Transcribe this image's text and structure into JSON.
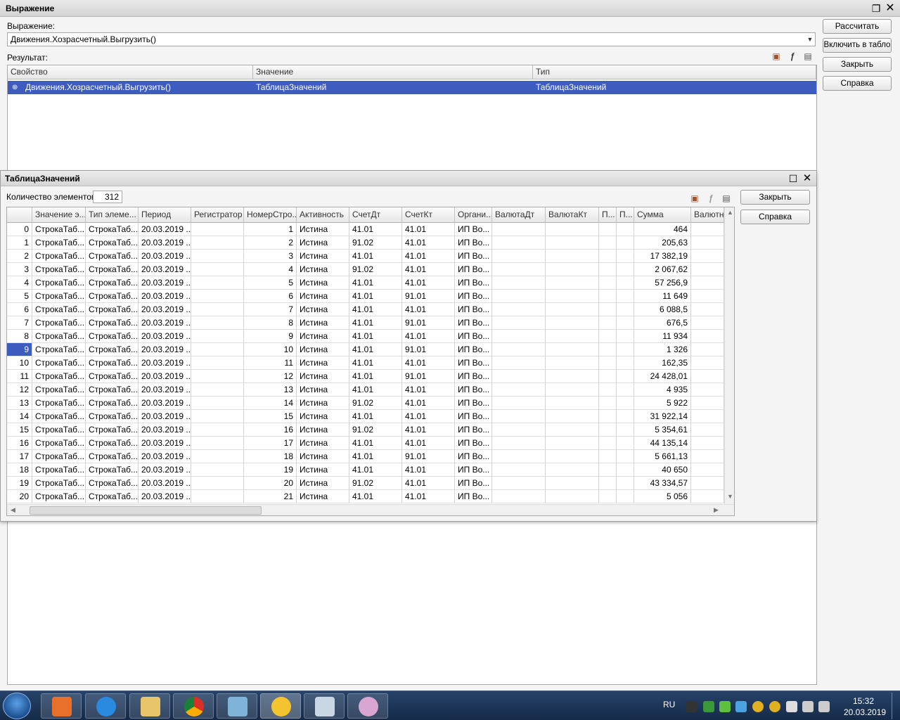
{
  "main": {
    "title": "Выражение",
    "expr_label": "Выражение:",
    "expr_value": "Движения.Хозрасчетный.Выгрузить()",
    "result_label": "Результат:",
    "buttons": {
      "calc": "Рассчитать",
      "include": "Включить в табло",
      "close": "Закрыть",
      "help": "Справка"
    },
    "result_headers": [
      "Свойство",
      "Значение",
      "Тип"
    ],
    "result_row": {
      "property": "Движения.Хозрасчетный.Выгрузить()",
      "value": "ТаблицаЗначений",
      "type": "ТаблицаЗначений"
    }
  },
  "child": {
    "title": "ТаблицаЗначений",
    "count_label": "Количество элементов:",
    "count_value": "312",
    "buttons": {
      "close": "Закрыть",
      "help": "Справка"
    },
    "headers": [
      "Значение э...",
      "Тип элеме...",
      "Период",
      "Регистратор",
      "НомерСтро...",
      "Активность",
      "СчетДт",
      "СчетКт",
      "Органи...",
      "ВалютаДт",
      "ВалютаКт",
      "П...",
      "П...",
      "Сумма",
      "Валютна"
    ],
    "rows": [
      {
        "i": "0",
        "v": "СтрокаТаб...",
        "t": "СтрокаТаб...",
        "p": "20.03.2019 ...",
        "n": "1",
        "a": "Истина",
        "dt": "41.01",
        "kt": "41.01",
        "o": "ИП Во...",
        "s": "464"
      },
      {
        "i": "1",
        "v": "СтрокаТаб...",
        "t": "СтрокаТаб...",
        "p": "20.03.2019 ...",
        "n": "2",
        "a": "Истина",
        "dt": "91.02",
        "kt": "41.01",
        "o": "ИП Во...",
        "s": "205,63"
      },
      {
        "i": "2",
        "v": "СтрокаТаб...",
        "t": "СтрокаТаб...",
        "p": "20.03.2019 ...",
        "n": "3",
        "a": "Истина",
        "dt": "41.01",
        "kt": "41.01",
        "o": "ИП Во...",
        "s": "17 382,19"
      },
      {
        "i": "3",
        "v": "СтрокаТаб...",
        "t": "СтрокаТаб...",
        "p": "20.03.2019 ...",
        "n": "4",
        "a": "Истина",
        "dt": "91.02",
        "kt": "41.01",
        "o": "ИП Во...",
        "s": "2 067,62"
      },
      {
        "i": "4",
        "v": "СтрокаТаб...",
        "t": "СтрокаТаб...",
        "p": "20.03.2019 ...",
        "n": "5",
        "a": "Истина",
        "dt": "41.01",
        "kt": "41.01",
        "o": "ИП Во...",
        "s": "57 256,9"
      },
      {
        "i": "5",
        "v": "СтрокаТаб...",
        "t": "СтрокаТаб...",
        "p": "20.03.2019 ...",
        "n": "6",
        "a": "Истина",
        "dt": "41.01",
        "kt": "91.01",
        "o": "ИП Во...",
        "s": "11 649"
      },
      {
        "i": "6",
        "v": "СтрокаТаб...",
        "t": "СтрокаТаб...",
        "p": "20.03.2019 ...",
        "n": "7",
        "a": "Истина",
        "dt": "41.01",
        "kt": "41.01",
        "o": "ИП Во...",
        "s": "6 088,5"
      },
      {
        "i": "7",
        "v": "СтрокаТаб...",
        "t": "СтрокаТаб...",
        "p": "20.03.2019 ...",
        "n": "8",
        "a": "Истина",
        "dt": "41.01",
        "kt": "91.01",
        "o": "ИП Во...",
        "s": "676,5"
      },
      {
        "i": "8",
        "v": "СтрокаТаб...",
        "t": "СтрокаТаб...",
        "p": "20.03.2019 ...",
        "n": "9",
        "a": "Истина",
        "dt": "41.01",
        "kt": "41.01",
        "o": "ИП Во...",
        "s": "11 934"
      },
      {
        "i": "9",
        "v": "СтрокаТаб...",
        "t": "СтрокаТаб...",
        "p": "20.03.2019 ...",
        "n": "10",
        "a": "Истина",
        "dt": "41.01",
        "kt": "91.01",
        "o": "ИП Во...",
        "s": "1 326",
        "selected": true
      },
      {
        "i": "10",
        "v": "СтрокаТаб...",
        "t": "СтрокаТаб...",
        "p": "20.03.2019 ...",
        "n": "11",
        "a": "Истина",
        "dt": "41.01",
        "kt": "41.01",
        "o": "ИП Во...",
        "s": "162,35"
      },
      {
        "i": "11",
        "v": "СтрокаТаб...",
        "t": "СтрокаТаб...",
        "p": "20.03.2019 ...",
        "n": "12",
        "a": "Истина",
        "dt": "41.01",
        "kt": "91.01",
        "o": "ИП Во...",
        "s": "24 428,01"
      },
      {
        "i": "12",
        "v": "СтрокаТаб...",
        "t": "СтрокаТаб...",
        "p": "20.03.2019 ...",
        "n": "13",
        "a": "Истина",
        "dt": "41.01",
        "kt": "41.01",
        "o": "ИП Во...",
        "s": "4 935"
      },
      {
        "i": "13",
        "v": "СтрокаТаб...",
        "t": "СтрокаТаб...",
        "p": "20.03.2019 ...",
        "n": "14",
        "a": "Истина",
        "dt": "91.02",
        "kt": "41.01",
        "o": "ИП Во...",
        "s": "5 922"
      },
      {
        "i": "14",
        "v": "СтрокаТаб...",
        "t": "СтрокаТаб...",
        "p": "20.03.2019 ...",
        "n": "15",
        "a": "Истина",
        "dt": "41.01",
        "kt": "41.01",
        "o": "ИП Во...",
        "s": "31 922,14"
      },
      {
        "i": "15",
        "v": "СтрокаТаб...",
        "t": "СтрокаТаб...",
        "p": "20.03.2019 ...",
        "n": "16",
        "a": "Истина",
        "dt": "91.02",
        "kt": "41.01",
        "o": "ИП Во...",
        "s": "5 354,61"
      },
      {
        "i": "16",
        "v": "СтрокаТаб...",
        "t": "СтрокаТаб...",
        "p": "20.03.2019 ...",
        "n": "17",
        "a": "Истина",
        "dt": "41.01",
        "kt": "41.01",
        "o": "ИП Во...",
        "s": "44 135,14"
      },
      {
        "i": "17",
        "v": "СтрокаТаб...",
        "t": "СтрокаТаб...",
        "p": "20.03.2019 ...",
        "n": "18",
        "a": "Истина",
        "dt": "41.01",
        "kt": "91.01",
        "o": "ИП Во...",
        "s": "5 661,13"
      },
      {
        "i": "18",
        "v": "СтрокаТаб...",
        "t": "СтрокаТаб...",
        "p": "20.03.2019 ...",
        "n": "19",
        "a": "Истина",
        "dt": "41.01",
        "kt": "41.01",
        "o": "ИП Во...",
        "s": "40 650"
      },
      {
        "i": "19",
        "v": "СтрокаТаб...",
        "t": "СтрокаТаб...",
        "p": "20.03.2019 ...",
        "n": "20",
        "a": "Истина",
        "dt": "91.02",
        "kt": "41.01",
        "o": "ИП Во...",
        "s": "43 334,57"
      },
      {
        "i": "20",
        "v": "СтрокаТаб...",
        "t": "СтрокаТаб...",
        "p": "20.03.2019 ...",
        "n": "21",
        "a": "Истина",
        "dt": "41.01",
        "kt": "41.01",
        "o": "ИП Во...",
        "s": "5 056"
      }
    ]
  },
  "taskbar": {
    "apps": [
      "start-menu",
      "media-player",
      "internet-explorer",
      "file-explorer",
      "chrome",
      "notepad",
      "1c-enterprise",
      "snipping-tool",
      "paint"
    ],
    "lang": "RU",
    "time": "15:32",
    "date": "20.03.2019"
  },
  "colors": {
    "selection": "#3e5bc0",
    "taskbar": "#1f3a5f"
  }
}
